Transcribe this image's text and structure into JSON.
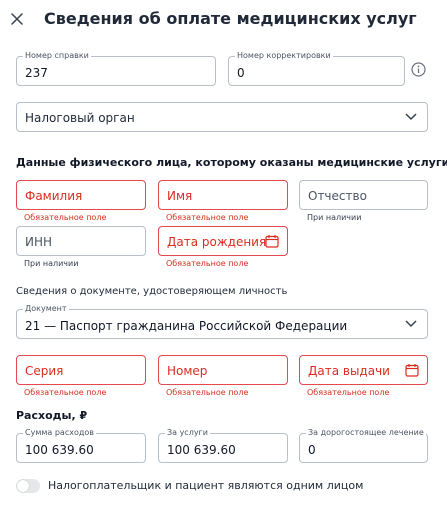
{
  "header": {
    "title": "Сведения об оплате медицинских услуг"
  },
  "certificate": {
    "number_label": "Номер справки",
    "number_value": "237",
    "correction_label": "Номер корректировки",
    "correction_value": "0"
  },
  "tax_authority": {
    "value": "Налоговый орган"
  },
  "person_section": {
    "title": "Данные физического лица, которому оказаны медицинские услуги",
    "surname_placeholder": "Фамилия",
    "name_placeholder": "Имя",
    "patronymic_placeholder": "Отчество",
    "inn_placeholder": "ИНН",
    "birthdate_placeholder": "Дата рождения",
    "required_hint": "Обязательное поле",
    "optional_hint": "При наличии"
  },
  "document_section": {
    "title": "Сведения о документе, удостоверяющем личность",
    "document_label": "Документ",
    "document_value": "21 — Паспорт гражданина Российской Федерации",
    "series_placeholder": "Серия",
    "number_placeholder": "Номер",
    "issue_date_placeholder": "Дата выдачи"
  },
  "expenses": {
    "title": "Расходы, ₽",
    "total_label": "Сумма расходов",
    "total_value": "100 639.60",
    "services_label": "За услуги",
    "services_value": "100 639.60",
    "expensive_label": "За дорогостоящее лечение",
    "expensive_value": "0"
  },
  "toggle": {
    "label": "Налогоплательщик и пациент являются одним лицом",
    "checked": false
  },
  "colors": {
    "error": "#e5484d",
    "border": "#b8bfc9",
    "text": "#1f2937"
  }
}
